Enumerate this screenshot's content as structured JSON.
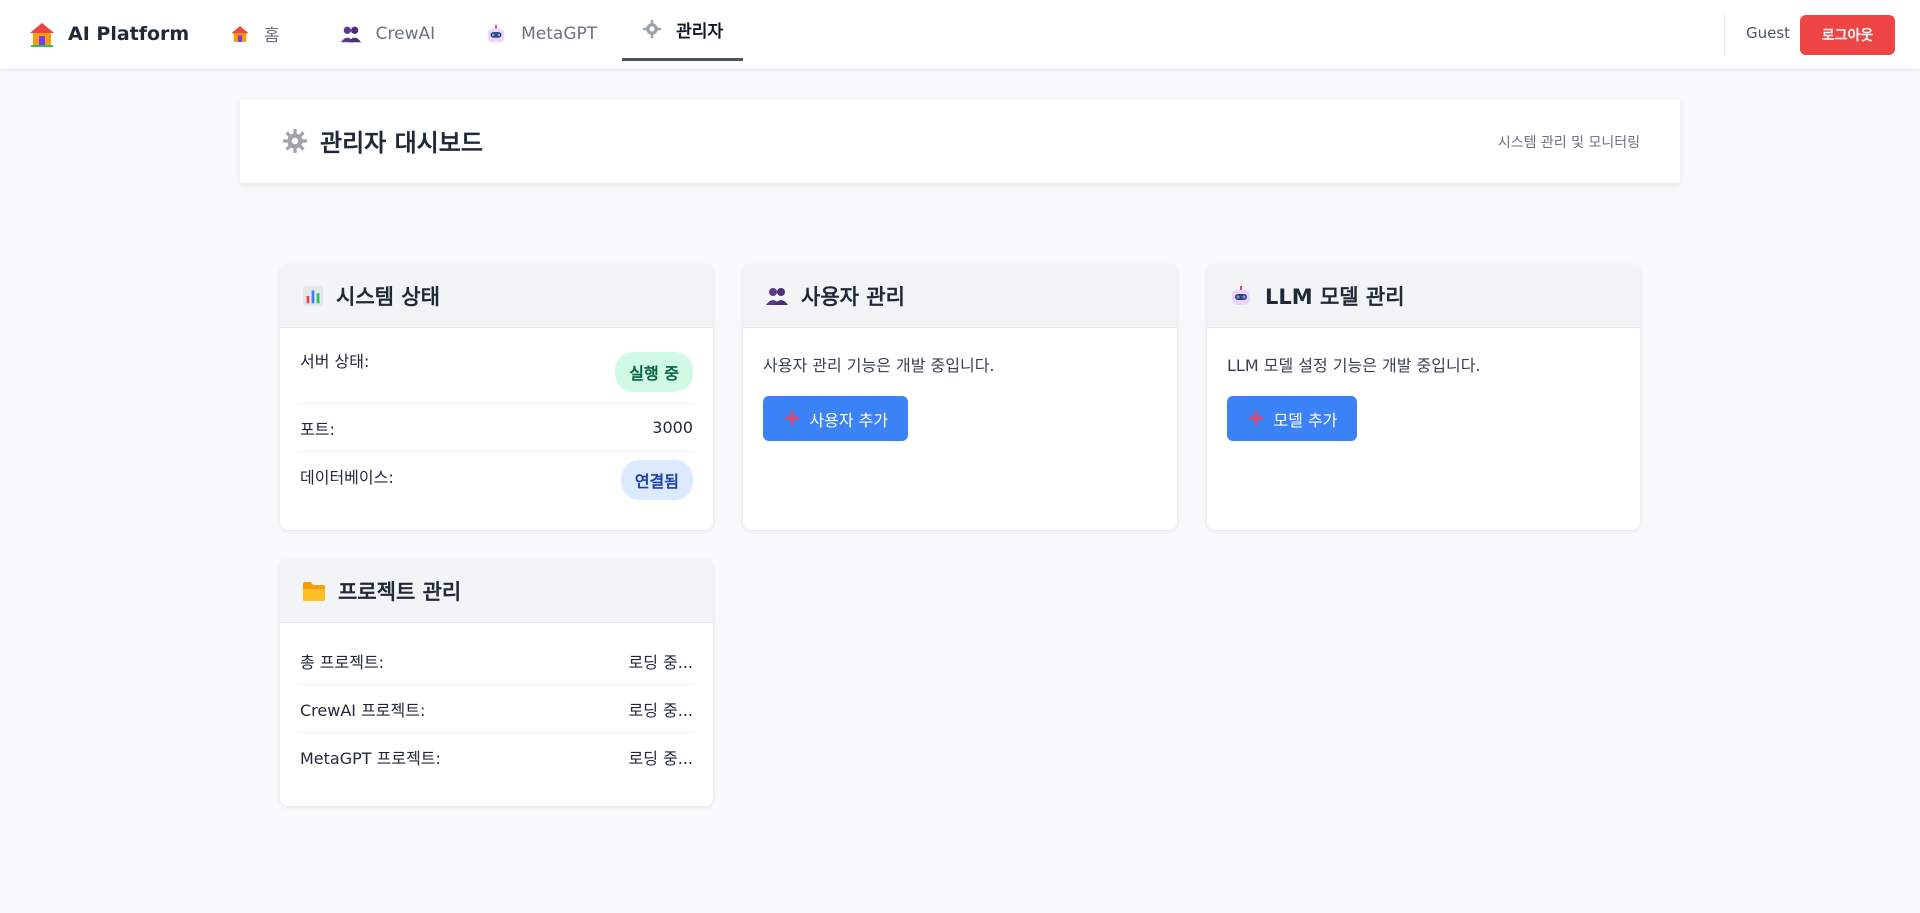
{
  "nav": {
    "brand": "AI Platform",
    "items": [
      {
        "label": "홈",
        "icon": "house-icon"
      },
      {
        "label": "CrewAI",
        "icon": "people-icon"
      },
      {
        "label": "MetaGPT",
        "icon": "robot-icon"
      },
      {
        "label": "관리자",
        "icon": "gear-icon",
        "active": true
      }
    ],
    "user": "Guest",
    "logout_label": "로그아웃"
  },
  "header": {
    "title": "관리자 대시보드",
    "subtitle": "시스템 관리 및 모니터링"
  },
  "system_card": {
    "title": "시스템 상태",
    "rows": [
      {
        "label": "서버 상태:",
        "value": "실행 중",
        "style": "green-badge"
      },
      {
        "label": "포트:",
        "value": "3000"
      },
      {
        "label": "데이터베이스:",
        "value": "연결됨",
        "style": "blue-badge"
      }
    ]
  },
  "user_card": {
    "title": "사용자 관리",
    "description": "사용자 관리 기능은 개발 중입니다.",
    "button_label": "사용자 추가"
  },
  "llm_card": {
    "title": "LLM 모델 관리",
    "description": "LLM 모델 설정 기능은 개발 중입니다.",
    "button_label": "모델 추가"
  },
  "project_card": {
    "title": "프로젝트 관리",
    "rows": [
      {
        "label": "총 프로젝트:",
        "value": "로딩 중..."
      },
      {
        "label": "CrewAI 프로젝트:",
        "value": "로딩 중..."
      },
      {
        "label": "MetaGPT 프로젝트:",
        "value": "로딩 중..."
      }
    ]
  },
  "colors": {
    "accent": "#3b82f6",
    "danger": "#ef4444",
    "success_bg": "#d1fae5",
    "info_bg": "#dbeafe"
  }
}
